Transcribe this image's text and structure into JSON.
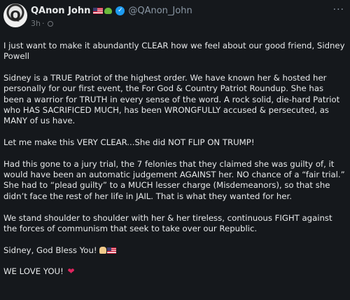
{
  "author": {
    "display_name": "QAnon John",
    "handle": "@QAnon_John",
    "avatar_letter": "Q",
    "name_badges": [
      "us-flag-icon",
      "frog-icon"
    ],
    "verified_icon": "verified-check-icon",
    "verified_glyph": "✓",
    "accent_color": "#1d9bf0"
  },
  "meta": {
    "time": "3h",
    "separator": "·",
    "visibility_icon": "globe-icon"
  },
  "more_button": {
    "label": "···"
  },
  "post": {
    "paragraphs": [
      "I just want to make it abundantly CLEAR how we feel about our good friend, Sidney Powell",
      "Sidney is a TRUE Patriot of the highest order. We have known her & hosted her personally for our first event, the For God & Country Patriot Roundup. She has been a warrior for TRUTH in every sense of the word. A rock solid, die-hard Patriot who HAS SACRIFICED MUCH, has been WRONGFULLY accused & persecuted, as MANY of us have.",
      "Let me make this VERY CLEAR...She did NOT FLIP ON TRUMP!",
      "Had this gone to a jury trial, the 7 felonies that they claimed she was guilty of, it would have been an automatic judgement AGAINST her. NO chance of a “fair trial.” She had to “plead guilty” to a MUCH lesser charge (Misdemeanors), so that she didn’t face the rest of her life in JAIL. That is what they wanted for her.",
      "We stand shoulder to shoulder with her & her tireless, continuous FIGHT against the forces of communism that seek to take over our Republic.",
      "Sidney, God Bless You!",
      "WE LOVE YOU!"
    ],
    "emoji": {
      "sign_off": [
        "pray-icon",
        "us-flag-icon"
      ],
      "closing": "heart-icon",
      "heart_glyph": "❤"
    }
  },
  "colors": {
    "background": "#15181c",
    "text": "#e7e9ea",
    "secondary_text": "#8b98a5",
    "heart": "#e0245e"
  }
}
